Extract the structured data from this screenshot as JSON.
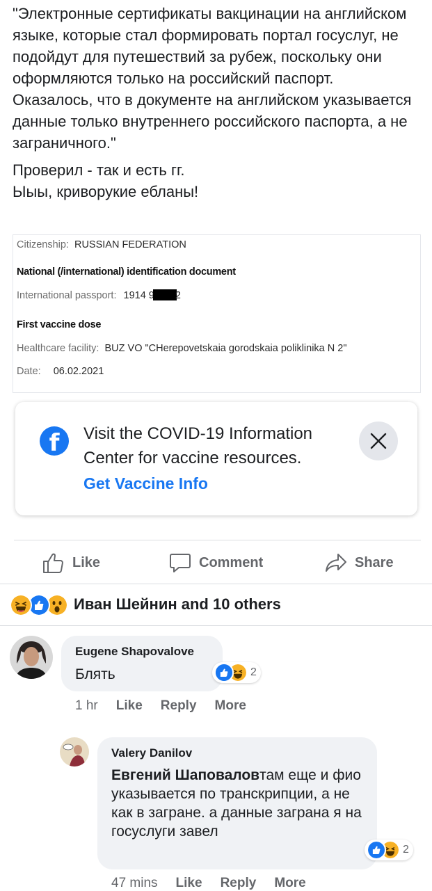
{
  "post": {
    "paragraph1": "\"Электронные сертификаты вакцинации на английском языке, которые стал формировать портал госуслуг, не подойдут для путешествий за рубеж, поскольку они оформляются только на российский паспорт.",
    "paragraph2": "Оказалось, что в документе на английском указывается данные только внутреннего российского паспорта, а не заграничного.\"",
    "paragraph3": "Проверил - так и есть гг.",
    "paragraph4": "Ыыы, криворукие ебланы!"
  },
  "document": {
    "citizenship_label": "Citizenship:",
    "citizenship_value": "RUSSIAN FEDERATION",
    "id_heading": "National (/international) identification document",
    "passport_label": "International passport:",
    "passport_prefix": "1914 9",
    "passport_suffix": "2",
    "dose_heading": "First vaccine dose",
    "facility_label": "Healthcare facility:",
    "facility_value": "BUZ VO \"CHerepovetskaia gorodskaia poliklinika N 2\"",
    "date_label": "Date:",
    "date_value": "06.02.2021"
  },
  "covid_card": {
    "text": "Visit the COVID-19 Information Center for vaccine resources.",
    "link": "Get Vaccine Info",
    "icon": "facebook-logo",
    "close_icon": "close-icon"
  },
  "actions": {
    "like": "Like",
    "comment": "Comment",
    "share": "Share"
  },
  "reactions": {
    "types": [
      "haha",
      "like",
      "wow"
    ],
    "summary": "Иван Шейнин and 10 others"
  },
  "comments": [
    {
      "author": "Eugene Shapovalove",
      "text": "Блять",
      "reaction_count": "2",
      "time": "1 hr",
      "like": "Like",
      "reply": "Reply",
      "more": "More"
    },
    {
      "author": "Valery Danilov",
      "mention": "Евгений Шаповалов",
      "text": "там еще и фио указывается по транскрипции, а не как в загране. а данные заграна я на госуслуги завел",
      "reaction_count": "2",
      "time": "47 mins",
      "like": "Like",
      "reply": "Reply",
      "more": "More"
    }
  ],
  "colors": {
    "facebook_blue": "#1877f2",
    "secondary_text": "#65676b",
    "bubble_bg": "#f0f2f5",
    "haha_yellow": "#f7b125"
  }
}
